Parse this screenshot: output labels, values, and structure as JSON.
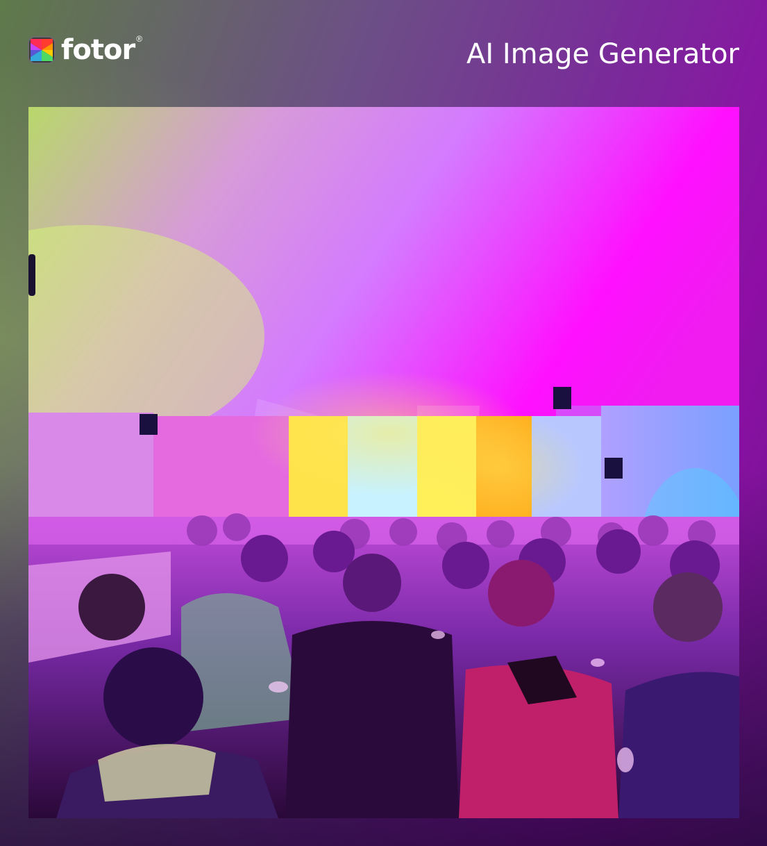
{
  "brand": {
    "name": "fotor",
    "registered_mark": "®"
  },
  "header": {
    "title": "AI Image Generator"
  },
  "image": {
    "description_icon": "ai-generated-party-image"
  }
}
